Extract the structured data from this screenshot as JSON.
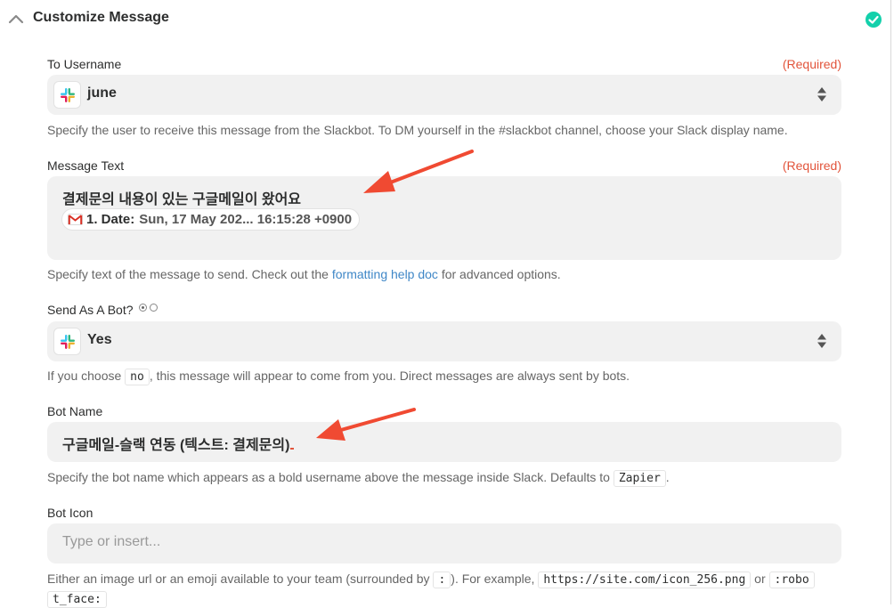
{
  "section": {
    "title": "Customize Message"
  },
  "to_username": {
    "label": "To Username",
    "required": "(Required)",
    "value": "june",
    "help": "Specify the user to receive this message from the Slackbot. To DM yourself in the #slackbot channel, choose your Slack display name."
  },
  "message_text": {
    "label": "Message Text",
    "required": "(Required)",
    "line1": "결제문의 내용이 있는 구글메일이 왔어요",
    "pill_label": "1. Date:",
    "pill_value": "Sun, 17 May 202... 16:15:28 +0900",
    "help_before": "Specify text of the message to send. Check out the ",
    "help_link": "formatting help doc",
    "help_after": " for advanced options."
  },
  "send_as_bot": {
    "label": "Send As A Bot?",
    "value": "Yes",
    "help_before": "If you choose ",
    "help_code": "no",
    "help_after": ", this message will appear to come from you. Direct messages are always sent by bots."
  },
  "bot_name": {
    "label": "Bot Name",
    "value": "구글메일-슬랙 연동 (텍스트: 결제문의)",
    "help_before": "Specify the bot name which appears as a bold username above the message inside Slack. Defaults to ",
    "help_code": "Zapier",
    "help_after": "."
  },
  "bot_icon": {
    "label": "Bot Icon",
    "placeholder": "Type or insert...",
    "help_before": "Either an image url or an emoji available to your team (surrounded by ",
    "help_code1": ":",
    "help_mid": "). For example, ",
    "help_code2": "https://site.com/icon_256.png",
    "help_or": " or ",
    "help_code3a": ":robo",
    "help_code3b": "t_face:"
  },
  "colors": {
    "required": "#e2543b",
    "link": "#3f87c7",
    "success": "#13d0ab",
    "annotation_arrow": "#f04a32",
    "field_bg": "#f1f1f1"
  },
  "icons": [
    "chevron-up-icon",
    "check-circle-icon",
    "slack-icon",
    "sort-icon",
    "gmail-icon"
  ]
}
